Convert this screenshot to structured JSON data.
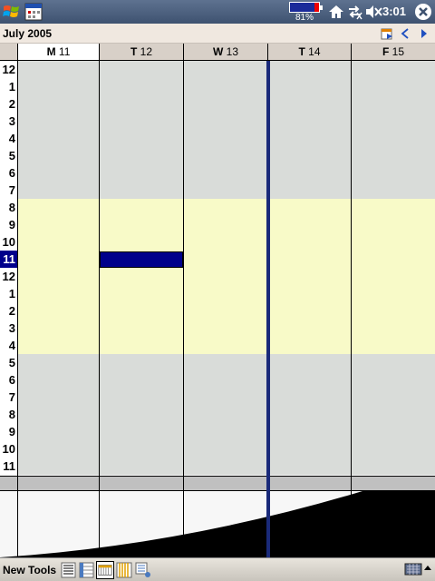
{
  "titlebar": {
    "battery_percent": 81,
    "battery_label": "81%",
    "clock": "3:01"
  },
  "datebar": {
    "month": "July 2005"
  },
  "days": [
    {
      "letter": "M",
      "num": "11",
      "today": true
    },
    {
      "letter": "T",
      "num": "12",
      "today": false
    },
    {
      "letter": "W",
      "num": "13",
      "today": false
    },
    {
      "letter": "T",
      "num": "14",
      "today": false
    },
    {
      "letter": "F",
      "num": "15",
      "today": false
    }
  ],
  "hours": [
    "12",
    "1",
    "2",
    "3",
    "4",
    "5",
    "6",
    "7",
    "8",
    "9",
    "10",
    "11",
    "12",
    "1",
    "2",
    "3",
    "4",
    "5",
    "6",
    "7",
    "8",
    "9",
    "10",
    "11"
  ],
  "selected_hour_index": 11,
  "menubar": {
    "new_label": "New",
    "tools_label": "Tools"
  },
  "colors": {
    "offhours": "#d9dcd9",
    "workhours": "#f8fac8",
    "selection": "#00008b"
  }
}
